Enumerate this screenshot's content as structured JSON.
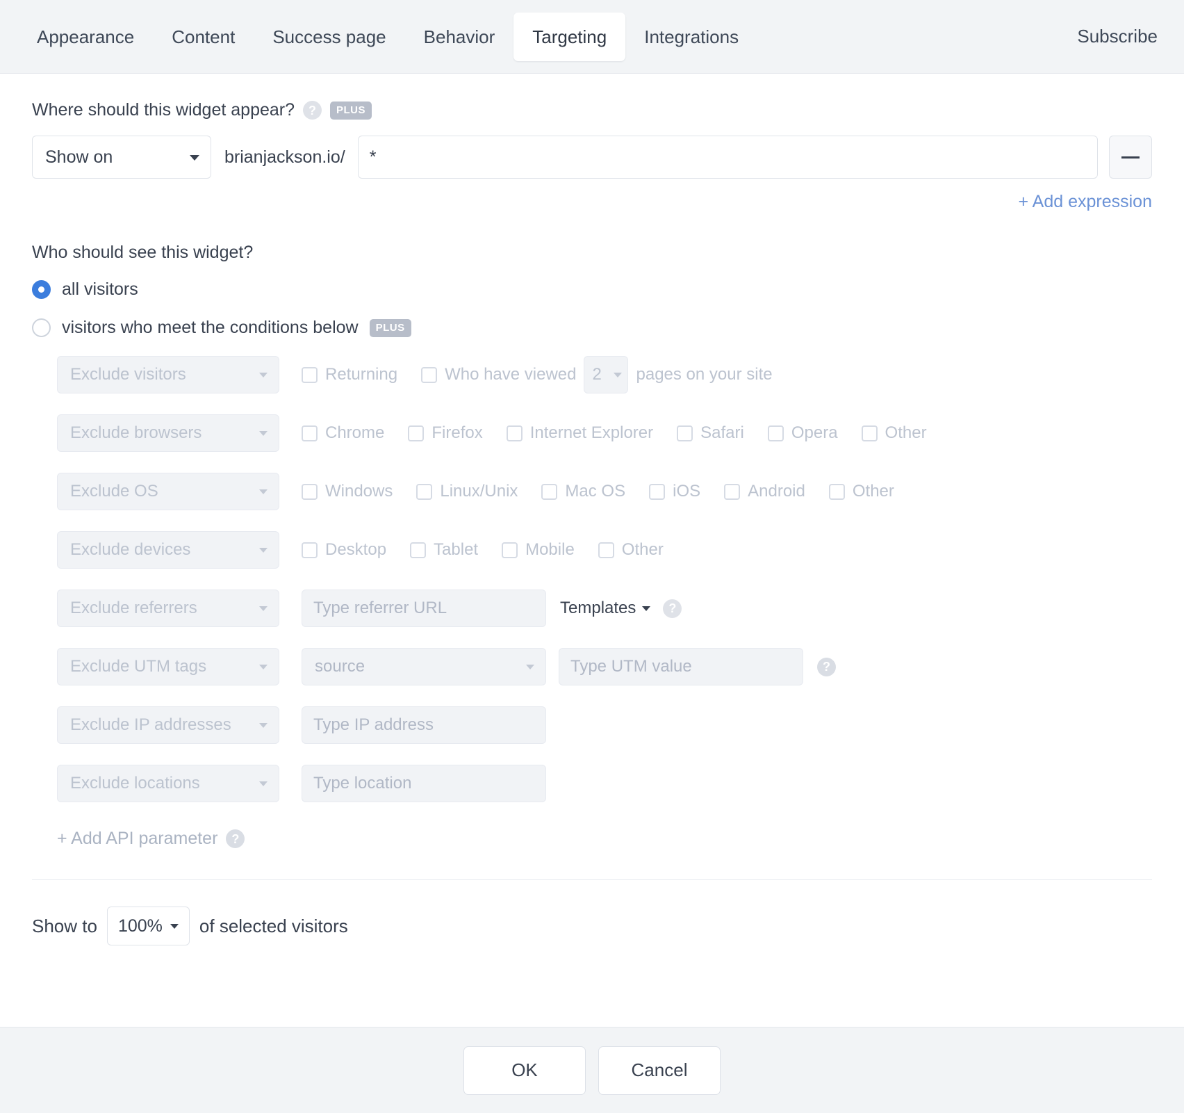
{
  "tabs": [
    {
      "label": "Appearance",
      "active": false
    },
    {
      "label": "Content",
      "active": false
    },
    {
      "label": "Success page",
      "active": false
    },
    {
      "label": "Behavior",
      "active": false
    },
    {
      "label": "Targeting",
      "active": true
    },
    {
      "label": "Integrations",
      "active": false
    }
  ],
  "subscribe_label": "Subscribe",
  "where": {
    "question": "Where should this widget appear?",
    "help_icon": "question-mark-icon",
    "plus_badge": "PLUS",
    "rule_select_value": "Show on",
    "domain_prefix": "brianjackson.io/",
    "pattern_value": "*",
    "pattern_placeholder": "",
    "remove_icon": "minus-icon",
    "add_expression_label": "+ Add expression",
    "link_color": "#6b92d6"
  },
  "who": {
    "question": "Who should see this widget?",
    "options": [
      {
        "label": "all visitors",
        "selected": true,
        "plus": null
      },
      {
        "label": "visitors who meet the conditions below",
        "selected": false,
        "plus": "PLUS"
      }
    ],
    "accent_color": "#3b7ddd"
  },
  "conditions": [
    {
      "select": "Exclude visitors",
      "checkboxes": [
        {
          "label": "Returning",
          "checked": false
        },
        {
          "label": "Who have viewed",
          "checked": false
        }
      ],
      "pages_value": "2",
      "pages_suffix": "pages on your site"
    },
    {
      "select": "Exclude browsers",
      "checkboxes": [
        {
          "label": "Chrome",
          "checked": false
        },
        {
          "label": "Firefox",
          "checked": false
        },
        {
          "label": "Internet Explorer",
          "checked": false
        },
        {
          "label": "Safari",
          "checked": false
        },
        {
          "label": "Opera",
          "checked": false
        },
        {
          "label": "Other",
          "checked": false
        }
      ]
    },
    {
      "select": "Exclude OS",
      "checkboxes": [
        {
          "label": "Windows",
          "checked": false
        },
        {
          "label": "Linux/Unix",
          "checked": false
        },
        {
          "label": "Mac OS",
          "checked": false
        },
        {
          "label": "iOS",
          "checked": false
        },
        {
          "label": "Android",
          "checked": false
        },
        {
          "label": "Other",
          "checked": false
        }
      ]
    },
    {
      "select": "Exclude devices",
      "checkboxes": [
        {
          "label": "Desktop",
          "checked": false
        },
        {
          "label": "Tablet",
          "checked": false
        },
        {
          "label": "Mobile",
          "checked": false
        },
        {
          "label": "Other",
          "checked": false
        }
      ]
    },
    {
      "select": "Exclude referrers",
      "text_placeholder": "Type referrer URL",
      "templates_label": "Templates",
      "help_icon": "question-mark-icon"
    },
    {
      "select": "Exclude UTM tags",
      "second_select": "source",
      "text_placeholder": "Type UTM value",
      "help_icon": "question-mark-icon"
    },
    {
      "select": "Exclude IP addresses",
      "text_placeholder": "Type IP address"
    },
    {
      "select": "Exclude locations",
      "text_placeholder": "Type location"
    }
  ],
  "add_api": {
    "label": "+ Add API parameter",
    "help_icon": "question-mark-icon"
  },
  "show_to": {
    "prefix": "Show to",
    "percent": "100%",
    "suffix": "of selected visitors"
  },
  "footer": {
    "ok_label": "OK",
    "cancel_label": "Cancel"
  }
}
